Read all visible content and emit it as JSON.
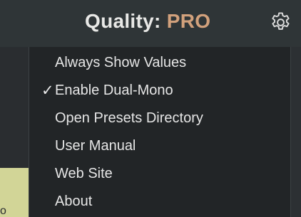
{
  "header": {
    "title_prefix": "Quality:",
    "title_value": "PRO",
    "settings_icon": "gear-icon",
    "title_value_color": "#d2a17c"
  },
  "menu": {
    "items": [
      {
        "label": "Always Show Values",
        "checked": false
      },
      {
        "label": "Enable Dual-Mono",
        "checked": true,
        "check_mark": "✓"
      },
      {
        "label": "Open Presets Directory",
        "checked": false
      },
      {
        "label": "User Manual",
        "checked": false
      },
      {
        "label": "Web Site",
        "checked": false
      },
      {
        "label": "About",
        "checked": false
      }
    ]
  },
  "background": {
    "partial_glyph": "o"
  }
}
